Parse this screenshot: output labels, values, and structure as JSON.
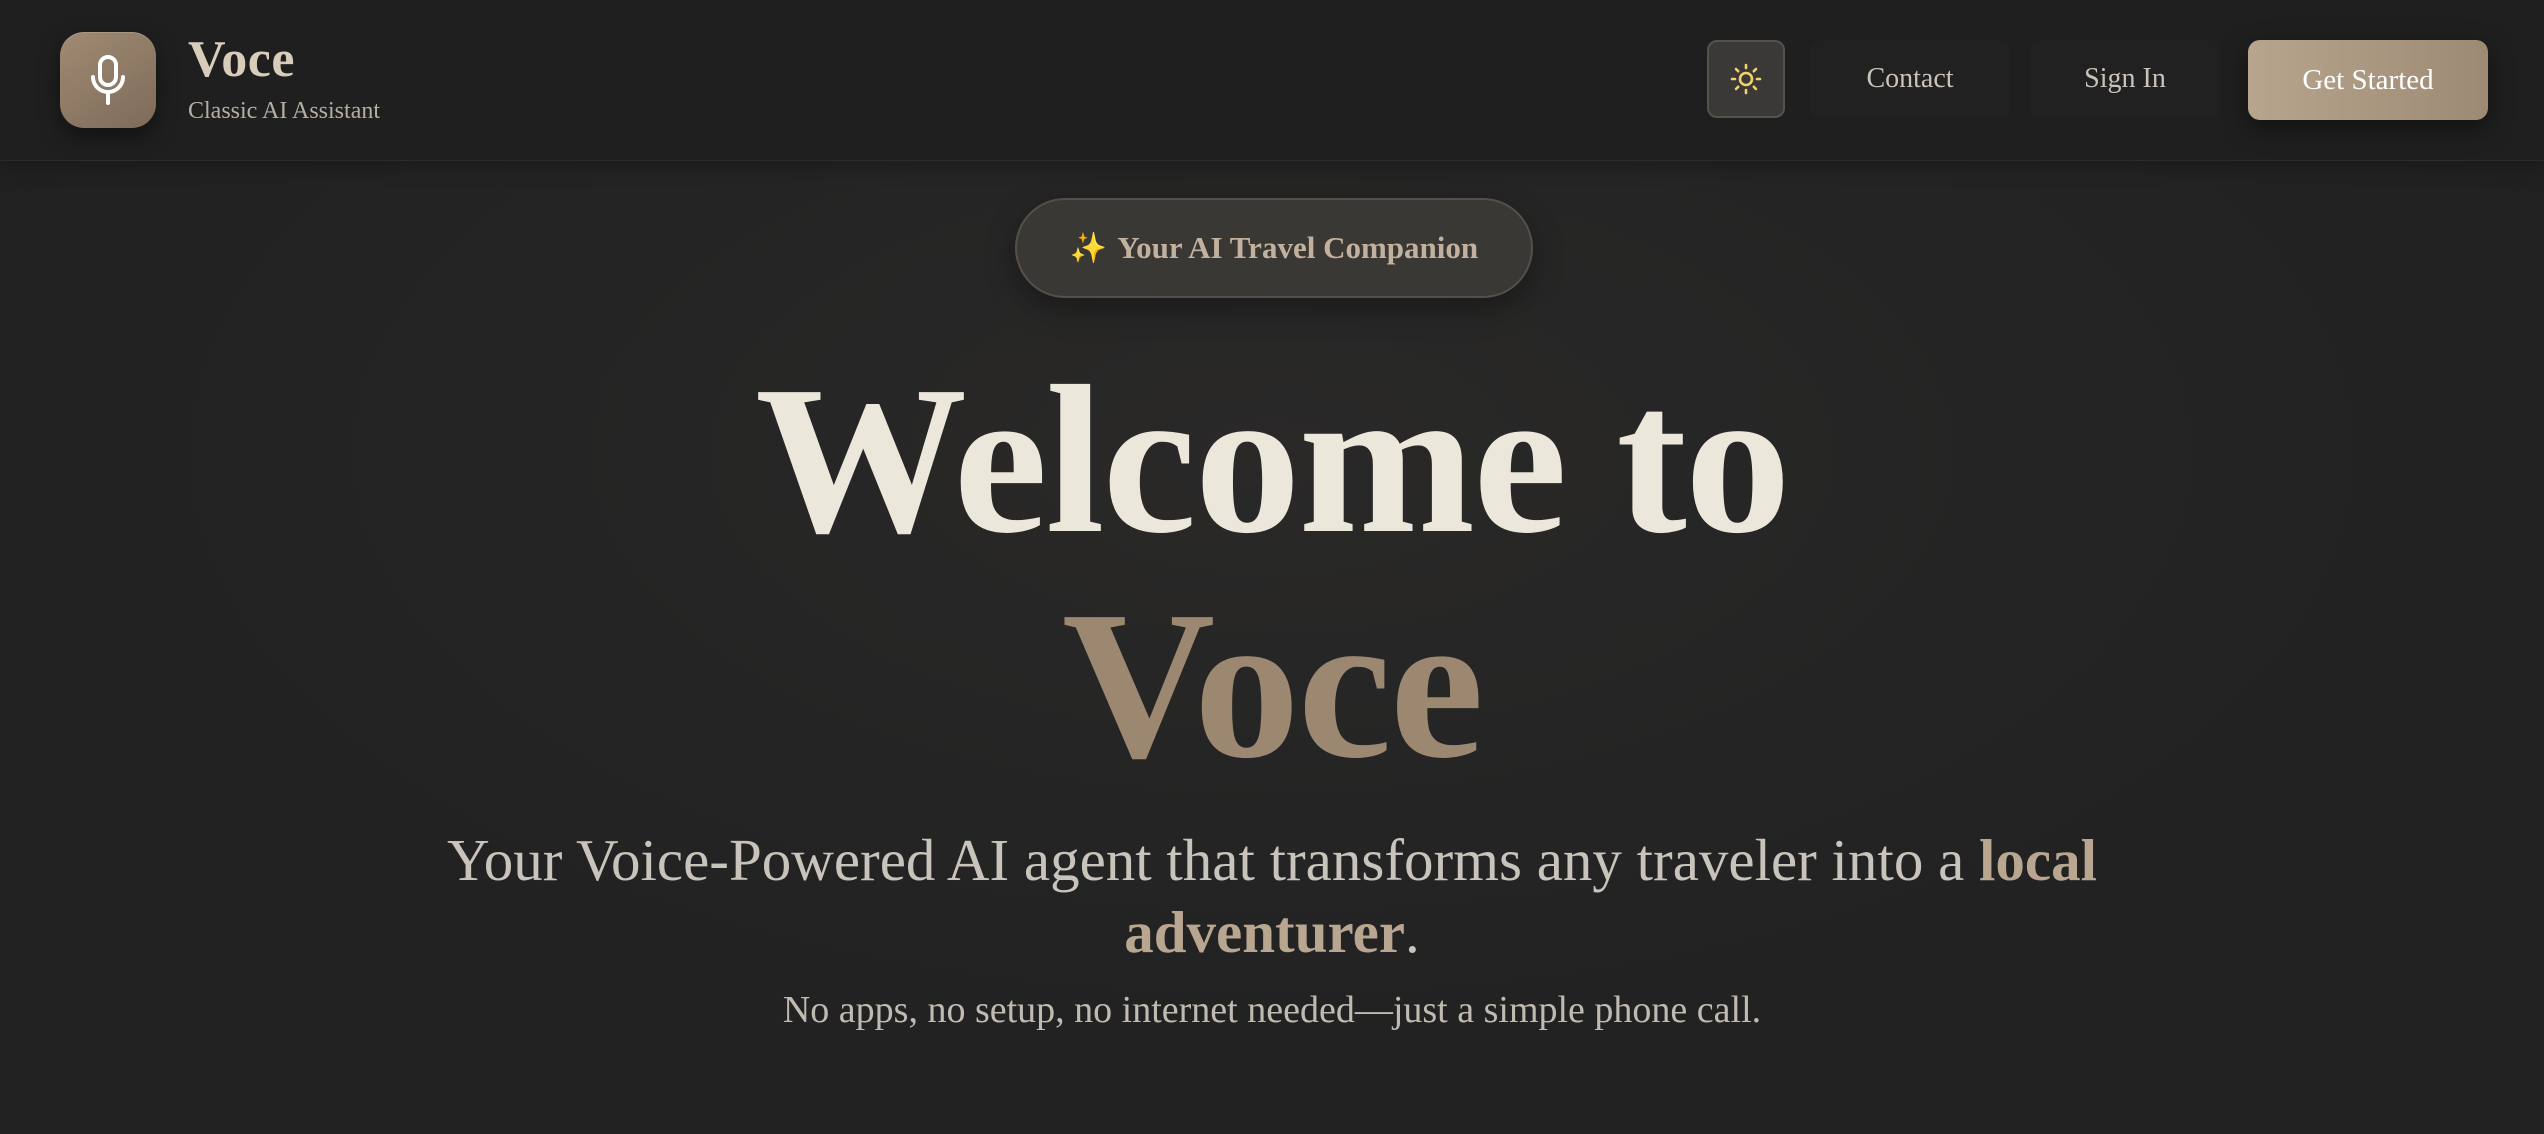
{
  "header": {
    "brand_name": "Voce",
    "brand_subtitle": "Classic AI Assistant",
    "logo_icon": "microphone-icon",
    "theme_toggle_icon": "sun-icon",
    "nav": {
      "contact_label": "Contact",
      "signin_label": "Sign In",
      "cta_label": "Get Started"
    }
  },
  "hero": {
    "badge_icon": "sparkles-icon",
    "badge_emoji": "✨",
    "badge_label": "Your AI Travel Companion",
    "title_line1": "Welcome to",
    "title_line2": "Voce",
    "tagline_prefix": "Your Voice-Powered AI agent that transforms any traveler into a ",
    "tagline_highlight": "local adventurer",
    "tagline_suffix": ".",
    "subtagline": "No apps, no setup, no internet needed—just a simple phone call."
  },
  "colors": {
    "background": "#232323",
    "header_background": "#1f1f1f",
    "accent": "#9c8771",
    "accent_light": "#b8a58e",
    "title_text": "#ece7db",
    "sun_icon": "#f2d36a"
  }
}
